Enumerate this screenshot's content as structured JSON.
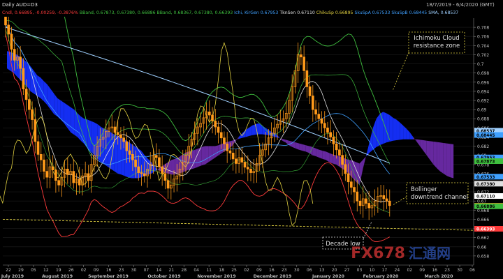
{
  "header": {
    "title": "Daily AUD=D3",
    "date_range": "18/7/2019 - 6/4/2020 (GMT)",
    "legend_items": [
      {
        "text": "Cndl, 0.66895, -0.00259, -0.3876%",
        "color": "#ff3b3b"
      },
      {
        "text": "BBand, 0.67873, 0.67380, 0.66886",
        "color": "#3fbf3f"
      },
      {
        "text": "BBand, 0.68367, 0.67380, 0.66393",
        "color": "#3fbf3f"
      },
      {
        "text": "Ichi, KirGen 0.67953",
        "color": "#3fa0ff"
      },
      {
        "text": "TknSen 0.67110",
        "color": "#e0e0e0"
      },
      {
        "text": "ChikuSp 0.66895",
        "color": "#e0d040"
      },
      {
        "text": "SkuSpA 0.67533",
        "color": "#3fa0ff"
      },
      {
        "text": "SkuSpB 0.68445",
        "color": "#3fa0ff"
      },
      {
        "text": "SMA, 0.68537",
        "color": "#9fd0ff"
      }
    ]
  },
  "annotations": {
    "ichimoku": "Ichimoku Cloud\nresistance zone",
    "bollinger": "Bollinger\ndowntrend channel",
    "decade_low": "Decade low"
  },
  "watermark": {
    "text": "FX678",
    "suffix": "汇通网"
  },
  "price_tags": [
    {
      "value": "0.68537",
      "color": "#9fd0ff",
      "text_color": "#000000"
    },
    {
      "value": "0.68445",
      "color": "#3fa0ff",
      "text_color": "#000000"
    },
    {
      "value": "0.67953",
      "color": "#3fa0ff",
      "text_color": "#000000"
    },
    {
      "value": "0.67873",
      "color": "#3fbf3f",
      "text_color": "#000000"
    },
    {
      "value": "0.67533",
      "color": "#3fa0ff",
      "text_color": "#000000"
    },
    {
      "value": "0.67380",
      "color": "#e0e0e0",
      "text_color": "#000000"
    },
    {
      "value": "0.67110",
      "color": "#ffffff",
      "text_color": "#000000"
    },
    {
      "value": "0.66895",
      "color": "#ffa020",
      "text_color": "#000000"
    },
    {
      "value": "0.66886",
      "color": "#3fbf3f",
      "text_color": "#000000"
    },
    {
      "value": "0.66393",
      "color": "#ff3b3b",
      "text_color": "#ffffff"
    }
  ],
  "colors": {
    "candle_up": "#ff9a1a",
    "candle_down": "#ff9a1a",
    "cloud_bull": "#1530ff",
    "cloud_bear": "#6b2aa8",
    "sma": "#9fd0ff",
    "tenkan": "#e0e0e0",
    "kijun": "#3fa0ff",
    "chikou": "#e0d040",
    "bb_outer": "#ff3b3b",
    "bb_inner": "#3fbf3f",
    "trendline": "#e0d040",
    "annotation_border": "#e0d040"
  },
  "chart_data": {
    "type": "candlestick",
    "ylim": [
      0.656,
      0.71
    ],
    "y_ticks": [
      "0.708",
      "0.706",
      "0.704",
      "0.702",
      "0.7",
      "0.698",
      "0.696",
      "0.694",
      "0.692",
      "0.69",
      "0.688",
      "0.686",
      "0.684",
      "0.682",
      "0.68",
      "0.678",
      "0.676",
      "0.674",
      "0.672",
      "0.67",
      "0.668",
      "0.666",
      "0.664",
      "0.662",
      "0.66",
      "0.658"
    ],
    "x_ticks": [
      "22",
      "29",
      "05",
      "12",
      "19",
      "26",
      "02",
      "09",
      "16",
      "23",
      "30",
      "07",
      "14",
      "21",
      "28",
      "04",
      "11",
      "18",
      "25",
      "02",
      "09",
      "16",
      "23",
      "30",
      "06",
      "13",
      "20",
      "27",
      "03",
      "10",
      "17",
      "24",
      "02",
      "09",
      "16",
      "23",
      "30",
      "06"
    ],
    "x_months": [
      "July 2019",
      "August 2019",
      "September 2019",
      "October 2019",
      "November 2019",
      "December 2019",
      "January 2020",
      "February 2020",
      "March 2020"
    ],
    "closes": [
      0.7085,
      0.7065,
      0.7032,
      0.7008,
      0.7015,
      0.699,
      0.6945,
      0.6922,
      0.69,
      0.6878,
      0.683,
      0.6802,
      0.679,
      0.6765,
      0.6752,
      0.6775,
      0.6768,
      0.6745,
      0.6735,
      0.6752,
      0.677,
      0.6758,
      0.6765,
      0.674,
      0.6748,
      0.6735,
      0.6755,
      0.676,
      0.6745,
      0.678,
      0.68,
      0.682,
      0.6835,
      0.684,
      0.6852,
      0.686,
      0.6862,
      0.685,
      0.6845,
      0.6838,
      0.683,
      0.681,
      0.6802,
      0.679,
      0.6775,
      0.6762,
      0.676,
      0.6755,
      0.677,
      0.678,
      0.68,
      0.6795,
      0.6775,
      0.676,
      0.6745,
      0.6728,
      0.6735,
      0.6748,
      0.6755,
      0.677,
      0.6785,
      0.68,
      0.682,
      0.6835,
      0.6848,
      0.6862,
      0.687,
      0.6882,
      0.6895,
      0.6888,
      0.6875,
      0.6862,
      0.685,
      0.6838,
      0.6825,
      0.681,
      0.6805,
      0.6792,
      0.6782,
      0.6795,
      0.6785,
      0.6774,
      0.677,
      0.6762,
      0.6765,
      0.6782,
      0.68,
      0.6812,
      0.6825,
      0.6838,
      0.6848,
      0.686,
      0.6868,
      0.6875,
      0.688,
      0.6892,
      0.692,
      0.695,
      0.6985,
      0.702,
      0.7015,
      0.6985,
      0.695,
      0.693,
      0.69,
      0.689,
      0.688,
      0.687,
      0.686,
      0.685,
      0.684,
      0.6825,
      0.6812,
      0.68,
      0.678,
      0.676,
      0.6742,
      0.673,
      0.672,
      0.67,
      0.669,
      0.6705,
      0.6695,
      0.6685,
      0.669,
      0.67,
      0.671,
      0.6712,
      0.6705,
      0.67,
      0.669
    ],
    "cloud": {
      "span_a": [
        0.7028,
        0.7026,
        0.7023,
        0.702,
        0.7015,
        0.701,
        0.7002,
        0.6995,
        0.6985,
        0.6975,
        0.697,
        0.6962,
        0.6955,
        0.6945,
        0.6935,
        0.6925,
        0.692,
        0.6915,
        0.691,
        0.6905,
        0.69,
        0.6892,
        0.6885,
        0.688,
        0.6878,
        0.6875,
        0.6872,
        0.6868,
        0.6862,
        0.6858,
        0.6855,
        0.685,
        0.6845,
        0.6842,
        0.6838,
        0.6835,
        0.683,
        0.6825,
        0.682,
        0.6815,
        0.681,
        0.68,
        0.6792,
        0.6785,
        0.6775,
        0.6768,
        0.6765,
        0.6762,
        0.676,
        0.6758,
        0.6758,
        0.676,
        0.6762,
        0.6765,
        0.6768,
        0.677,
        0.6772,
        0.6775,
        0.6778,
        0.678,
        0.6785,
        0.679,
        0.6795,
        0.68,
        0.6805,
        0.681,
        0.6815,
        0.682,
        0.683,
        0.684,
        0.6848,
        0.6855,
        0.686,
        0.6865,
        0.6868,
        0.687,
        0.6865,
        0.686,
        0.6855,
        0.685,
        0.6848,
        0.684,
        0.6832,
        0.6828,
        0.6822,
        0.6818,
        0.6815,
        0.6812,
        0.681,
        0.6808,
        0.6805,
        0.68,
        0.6798,
        0.6795,
        0.6792,
        0.679,
        0.6785,
        0.6782,
        0.678,
        0.6775,
        0.677,
        0.6765,
        0.6758,
        0.675,
        0.6742,
        0.6735,
        0.677,
        0.68,
        0.683,
        0.686,
        0.688,
        0.689,
        0.6895,
        0.6892,
        0.6888,
        0.6882,
        0.6878,
        0.6872,
        0.6865,
        0.6858,
        0.685,
        0.684,
        0.683,
        0.682,
        0.681,
        0.68,
        0.679,
        0.678,
        0.6772,
        0.6765,
        0.676,
        0.6755,
        0.6752,
        0.675
      ],
      "span_b": [
        0.699,
        0.6985,
        0.698,
        0.6972,
        0.6965,
        0.6958,
        0.695,
        0.694,
        0.6935,
        0.693,
        0.6925,
        0.6918,
        0.691,
        0.69,
        0.689,
        0.6885,
        0.6878,
        0.687,
        0.686,
        0.685,
        0.6845,
        0.684,
        0.6832,
        0.6825,
        0.6815,
        0.6808,
        0.68,
        0.6792,
        0.6785,
        0.678,
        0.6775,
        0.677,
        0.6765,
        0.676,
        0.6758,
        0.6755,
        0.6752,
        0.675,
        0.675,
        0.675,
        0.6752,
        0.6755,
        0.6758,
        0.676,
        0.6765,
        0.677,
        0.6775,
        0.678,
        0.6785,
        0.679,
        0.6792,
        0.6795,
        0.68,
        0.6805,
        0.6808,
        0.681,
        0.6812,
        0.6815,
        0.6818,
        0.682,
        0.682,
        0.682,
        0.682,
        0.6822,
        0.6825,
        0.6828,
        0.683,
        0.6832,
        0.6834,
        0.6836,
        0.6838,
        0.684,
        0.6842,
        0.6844,
        0.6845,
        0.6846,
        0.6846,
        0.6845,
        0.6844,
        0.6842,
        0.684,
        0.6838,
        0.6836,
        0.6834,
        0.6832,
        0.683,
        0.6828,
        0.6826,
        0.6824,
        0.6822,
        0.682,
        0.6818,
        0.6815,
        0.6812,
        0.681,
        0.6808,
        0.6805,
        0.6802,
        0.68,
        0.6798,
        0.6795,
        0.6792,
        0.679,
        0.6788,
        0.6785,
        0.6782,
        0.679,
        0.6798,
        0.6806,
        0.6812,
        0.6818,
        0.6822,
        0.6825,
        0.6828,
        0.683,
        0.6832,
        0.6833,
        0.6834,
        0.6835,
        0.6835,
        0.6835,
        0.6835,
        0.6835,
        0.6834,
        0.6833,
        0.6832,
        0.6831,
        0.683,
        0.6829,
        0.6828,
        0.6827,
        0.6826,
        0.6825,
        0.6824
      ]
    },
    "sma": {
      "start": [
        0.708,
        0
      ],
      "end": [
        0.6782,
        1
      ]
    },
    "trendline": {
      "start": [
        0.665,
        0
      ],
      "end": [
        0.6652,
        1
      ]
    }
  }
}
